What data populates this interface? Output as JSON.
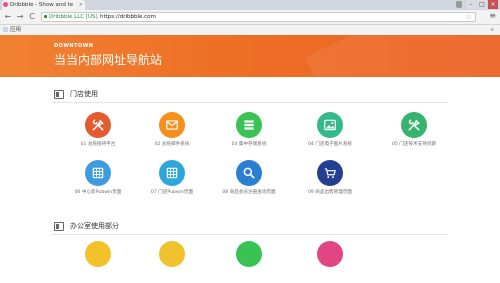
{
  "browser": {
    "tab_title": "Dribbble - Show and te",
    "tab_close": "×",
    "window_buttons": [
      "–",
      "□",
      "×"
    ],
    "nav": {
      "back": "←",
      "forward": "→",
      "reload": "C"
    },
    "ev_label": "Dribbble LLC [US]",
    "url": "https://dribbble.com",
    "star": "☆",
    "menu": "≡",
    "bookmarks_apps": "应用",
    "bookmarks_other": "»"
  },
  "banner": {
    "brand": "DOWNTOWN",
    "title": "当当内部网址导航站",
    "accent_color": "#ee6f26"
  },
  "sections": [
    {
      "title": "门店使用",
      "tiles": [
        {
          "label": "01 总舵接待平台",
          "icon": "tools-icon",
          "color": "#e35b2f"
        },
        {
          "label": "02 总舵邮件系统",
          "icon": "mail-icon",
          "color": "#f5901e"
        },
        {
          "label": "03 集中存储系统",
          "icon": "database-icon",
          "color": "#39c354"
        },
        {
          "label": "04 门店电子图片系统",
          "icon": "image-icon",
          "color": "#34b98a"
        },
        {
          "label": "05 门店技术支持问题",
          "icon": "tools-icon",
          "color": "#36b36c"
        },
        {
          "label": "06 中心影Pubwin页面",
          "icon": "grid-icon",
          "color": "#3d9be0"
        },
        {
          "label": "07 门店Pubwin页面",
          "icon": "grid-icon",
          "color": "#2fa6d9"
        },
        {
          "label": "08 商品会员注册查询页面",
          "icon": "search-icon",
          "color": "#2a7fd4"
        },
        {
          "label": "09 商品出售管理页面",
          "icon": "cart-icon",
          "color": "#243f8f"
        }
      ]
    },
    {
      "title": "办公室使用部分",
      "tiles": [
        {
          "label": "",
          "icon": "circle-icon",
          "color": "#f4c12a"
        },
        {
          "label": "",
          "icon": "circle-icon",
          "color": "#f0c22e"
        },
        {
          "label": "",
          "icon": "circle-icon",
          "color": "#39c354"
        },
        {
          "label": "",
          "icon": "circle-icon",
          "color": "#e24583"
        }
      ]
    }
  ]
}
